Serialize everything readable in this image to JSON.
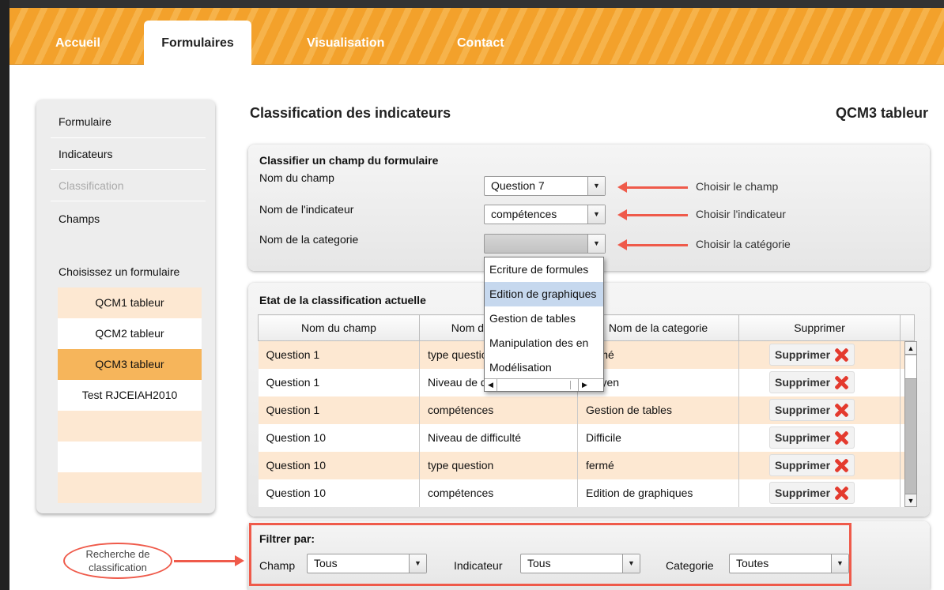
{
  "nav": {
    "tabs": [
      {
        "label": "Accueil"
      },
      {
        "label": "Formulaires"
      },
      {
        "label": "Visualisation"
      },
      {
        "label": "Contact"
      }
    ]
  },
  "sidebar": {
    "links": [
      "Formulaire",
      "Indicateurs",
      "Classification",
      "Champs"
    ],
    "choose_label": "Choisissez un formulaire",
    "forms": [
      "QCM1 tableur",
      "QCM2 tableur",
      "QCM3 tableur",
      "Test RJCEIAH2010",
      "",
      "",
      ""
    ]
  },
  "main": {
    "title": "Classification des indicateurs",
    "form_name": "QCM3 tableur"
  },
  "classify": {
    "title": "Classifier un champ du formulaire",
    "field_label": "Nom du champ",
    "field_value": "Question 7",
    "indicator_label": "Nom de l'indicateur",
    "indicator_value": "compétences",
    "category_label": "Nom de la categorie",
    "category_value": ""
  },
  "annotations": {
    "choose_field": "Choisir le champ",
    "choose_indicator": "Choisir l'indicateur",
    "choose_category": "Choisir la catégorie",
    "search_bubble": "Recherche de classification"
  },
  "dropdown": {
    "options": [
      "Ecriture de formules",
      "Edition de graphiques",
      "Gestion de tables",
      "Manipulation des en",
      "Modélisation"
    ]
  },
  "state": {
    "title": "Etat de la classification actuelle",
    "headers": [
      "Nom du champ",
      "Nom de l'indicateur",
      "Nom de la categorie",
      "Supprimer"
    ],
    "rows": [
      [
        "Question 1",
        "type question",
        "fermé"
      ],
      [
        "Question 1",
        "Niveau de difficulté",
        "Moyen"
      ],
      [
        "Question 1",
        "compétences",
        "Gestion de tables"
      ],
      [
        "Question 10",
        "Niveau de difficulté",
        "Difficile"
      ],
      [
        "Question 10",
        "type question",
        "fermé"
      ],
      [
        "Question 10",
        "compétences",
        "Edition de graphiques"
      ]
    ],
    "delete_label": "Supprimer"
  },
  "filter": {
    "title": "Filtrer par:",
    "champ_label": "Champ",
    "champ_value": "Tous",
    "indicateur_label": "Indicateur",
    "indicateur_value": "Tous",
    "categorie_label": "Categorie",
    "categorie_value": "Toutes"
  }
}
